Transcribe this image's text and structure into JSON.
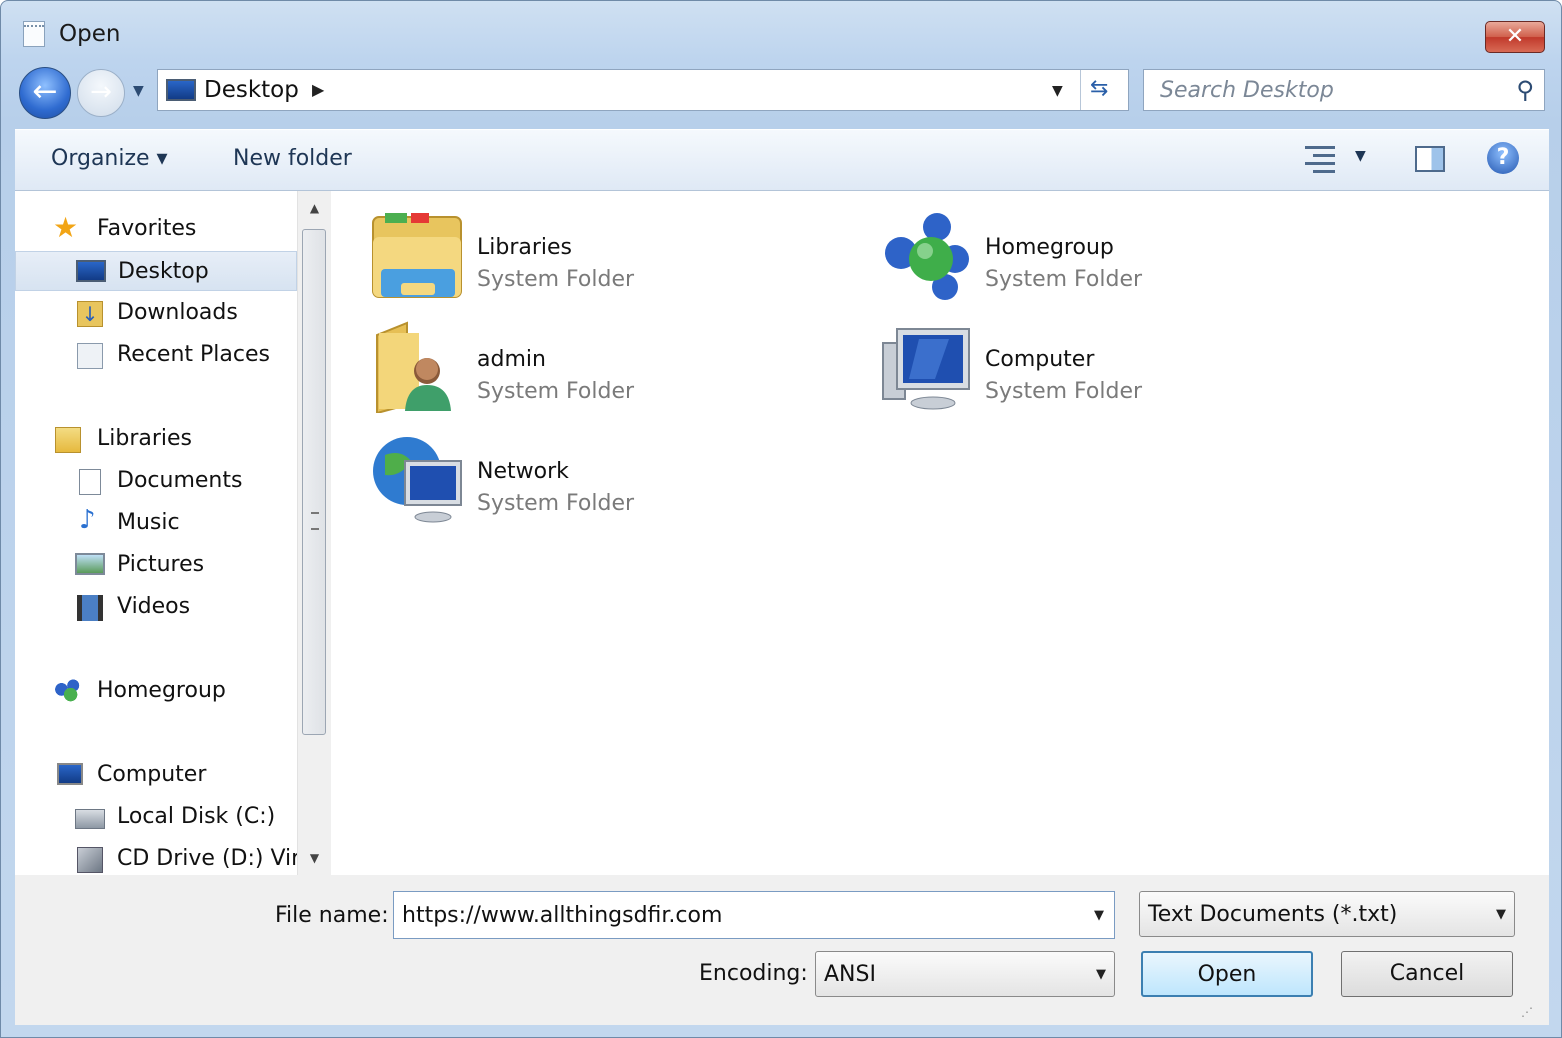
{
  "window": {
    "title": "Open",
    "close_label": "✕"
  },
  "navbar": {
    "address_location": "Desktop",
    "search_placeholder": "Search Desktop"
  },
  "toolbar": {
    "organize_label": "Organize ▾",
    "new_folder_label": "New folder",
    "help_label": "?"
  },
  "sidebar": {
    "favorites": "Favorites",
    "desktop": "Desktop",
    "downloads": "Downloads",
    "recent_places": "Recent Places",
    "libraries": "Libraries",
    "documents": "Documents",
    "music": "Music",
    "pictures": "Pictures",
    "videos": "Videos",
    "homegroup": "Homegroup",
    "computer": "Computer",
    "local_disk": "Local Disk (C:)",
    "cd_drive": "CD Drive (D:) Virt"
  },
  "content": {
    "items": [
      {
        "name": "Libraries",
        "type": "System Folder",
        "icon": "libraries-icon"
      },
      {
        "name": "Homegroup",
        "type": "System Folder",
        "icon": "homegroup-icon"
      },
      {
        "name": "admin",
        "type": "System Folder",
        "icon": "user-folder-icon"
      },
      {
        "name": "Computer",
        "type": "System Folder",
        "icon": "computer-icon"
      },
      {
        "name": "Network",
        "type": "System Folder",
        "icon": "network-icon"
      }
    ]
  },
  "bottom": {
    "file_name_label": "File name:",
    "file_name_value": "https://www.allthingsdfir.com",
    "file_type_value": "Text Documents (*.txt)",
    "encoding_label": "Encoding:",
    "encoding_value": "ANSI",
    "open_label": "Open",
    "cancel_label": "Cancel"
  },
  "colors": {
    "accent": "#3c7fb1",
    "selection": "#d7e3f1",
    "window_chrome": "#bdd4ee"
  }
}
